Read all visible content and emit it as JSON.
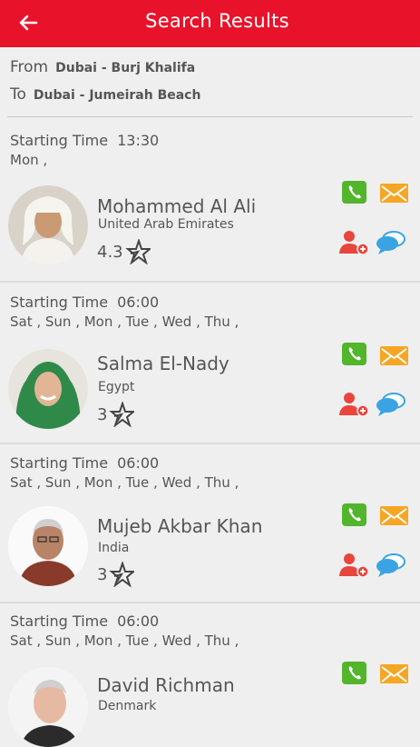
{
  "header": {
    "title": "Search Results",
    "back_icon": "arrow-left-icon"
  },
  "route": {
    "from_label": "From",
    "from_value": "Dubai - Burj Khalifa",
    "to_label": "To",
    "to_value": "Dubai - Jumeirah Beach"
  },
  "results": [
    {
      "starting_label": "Starting Time",
      "time": "13:30",
      "days": "Mon ,",
      "name": "Mohammed Al Ali",
      "country": "United Arab Emirates",
      "rating": "4.3"
    },
    {
      "starting_label": "Starting Time",
      "time": "06:00",
      "days": "Sat , Sun , Mon , Tue , Wed , Thu ,",
      "name": "Salma El-Nady",
      "country": "Egypt",
      "rating": "3"
    },
    {
      "starting_label": "Starting Time",
      "time": "06:00",
      "days": "Sat , Sun , Mon , Tue , Wed , Thu ,",
      "name": "Mujeb Akbar Khan",
      "country": "India",
      "rating": "3"
    },
    {
      "starting_label": "Starting Time",
      "time": "06:00",
      "days": "Sat , Sun , Mon , Tue , Wed , Thu ,",
      "name": "David Richman",
      "country": "Denmark",
      "rating": ""
    }
  ],
  "colors": {
    "appbar": "#e8132a",
    "call": "#52b52c",
    "mail": "#f5a623",
    "add_user": "#e8453c",
    "chat": "#3aa3e3"
  }
}
